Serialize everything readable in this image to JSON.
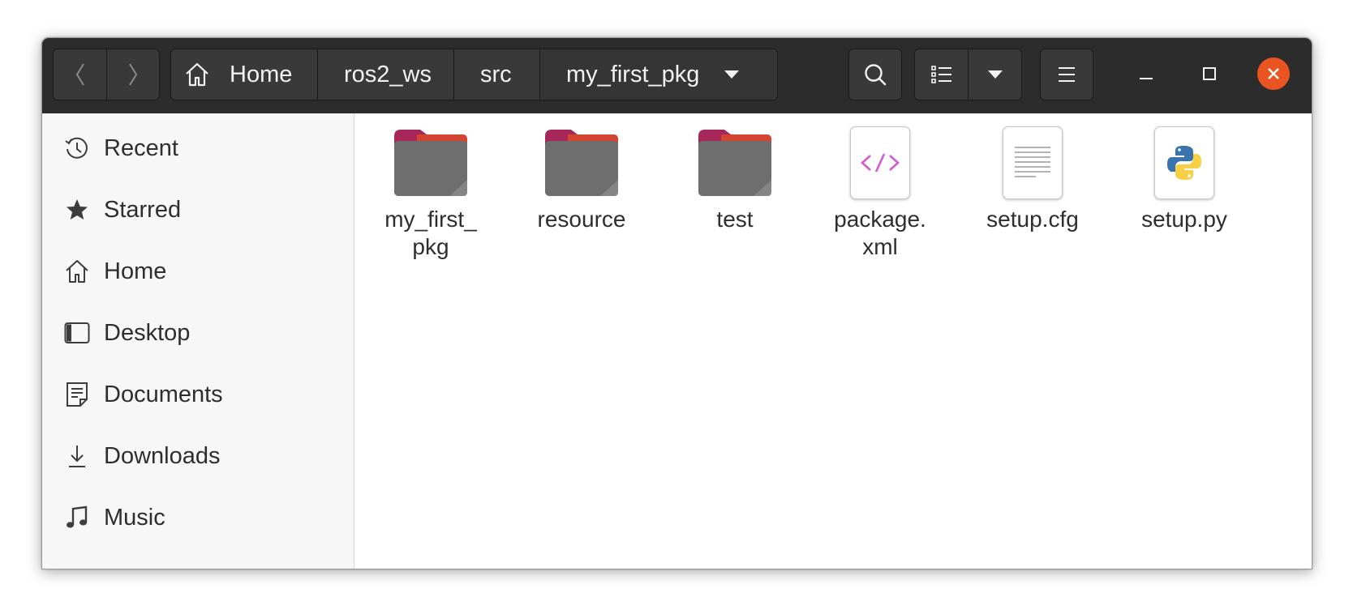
{
  "window": {
    "path": [
      {
        "label": "Home",
        "icon": "home-icon"
      },
      {
        "label": "ros2_ws"
      },
      {
        "label": "src"
      },
      {
        "label": "my_first_pkg",
        "active": true
      }
    ],
    "accent": "#e95420"
  },
  "sidebar": {
    "items": [
      {
        "label": "Recent",
        "icon": "recent-icon"
      },
      {
        "label": "Starred",
        "icon": "star-icon"
      },
      {
        "label": "Home",
        "icon": "home-icon"
      },
      {
        "label": "Desktop",
        "icon": "desktop-icon"
      },
      {
        "label": "Documents",
        "icon": "documents-icon"
      },
      {
        "label": "Downloads",
        "icon": "downloads-icon"
      },
      {
        "label": "Music",
        "icon": "music-icon"
      }
    ]
  },
  "files": [
    {
      "name_line1": "my_first_",
      "name_line2": "pkg",
      "type": "folder"
    },
    {
      "name_line1": "resource",
      "name_line2": "",
      "type": "folder"
    },
    {
      "name_line1": "test",
      "name_line2": "",
      "type": "folder"
    },
    {
      "name_line1": "package.",
      "name_line2": "xml",
      "type": "xml"
    },
    {
      "name_line1": "setup.cfg",
      "name_line2": "",
      "type": "text"
    },
    {
      "name_line1": "setup.py",
      "name_line2": "",
      "type": "python"
    }
  ],
  "colors": {
    "folder_top": "#a8275a",
    "folder_body": "#6e6e6e",
    "xml_glyph": "#d45ad0",
    "headerbar": "#2c2c2c"
  }
}
